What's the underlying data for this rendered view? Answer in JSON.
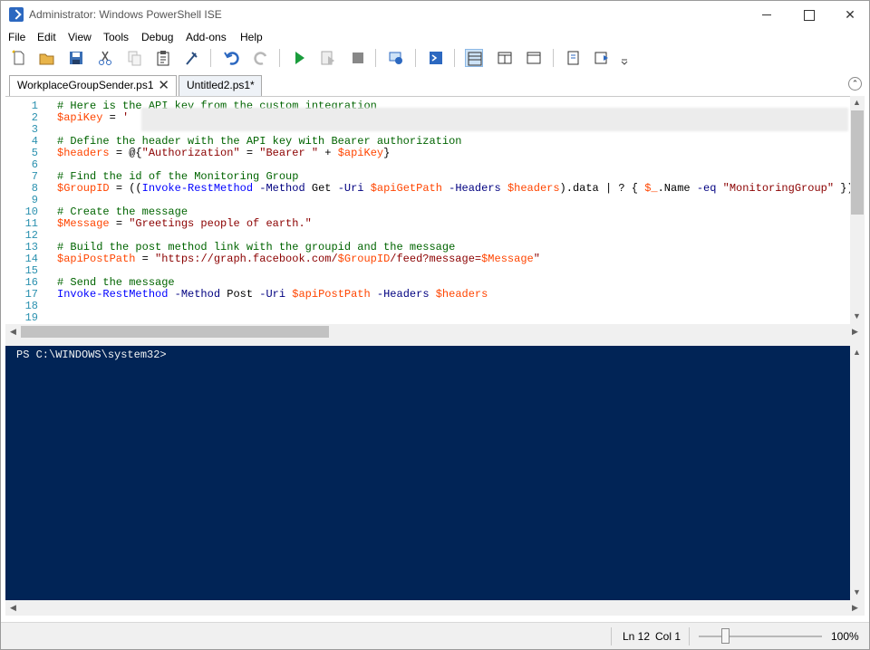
{
  "window": {
    "title": "Administrator: Windows PowerShell ISE"
  },
  "menu": [
    "File",
    "Edit",
    "View",
    "Tools",
    "Debug",
    "Add-ons",
    "Help"
  ],
  "toolbar_icons": [
    "new-script-icon",
    "open-icon",
    "save-icon",
    "cut-icon",
    "copy-icon",
    "paste-icon",
    "clear-console-icon",
    "undo-icon",
    "redo-icon",
    "run-script-icon",
    "run-selection-icon",
    "stop-icon",
    "new-remote-tab-icon",
    "start-powershell-icon",
    "script-pane-top-icon",
    "script-pane-right-icon",
    "script-pane-maximized-icon",
    "show-script-pane-icon",
    "show-command-window-icon",
    "toolbar-overflow-icon"
  ],
  "tabs": [
    {
      "label": "WorkplaceGroupSender.ps1",
      "active": true,
      "close": "✕"
    },
    {
      "label": "Untitled2.ps1*",
      "active": false
    }
  ],
  "script": {
    "lines": [
      {
        "n": "1",
        "text": "# Here is the API key from the custom integration"
      },
      {
        "n": "2",
        "text": "$apiKey = '"
      },
      {
        "n": "3",
        "text": ""
      },
      {
        "n": "4",
        "text": "# Define the header with the API key with Bearer authorization"
      },
      {
        "n": "5",
        "text": "$headers = @{\"Authorization\" = \"Bearer \" + $apiKey}"
      },
      {
        "n": "6",
        "text": ""
      },
      {
        "n": "7",
        "text": "# Find the id of the Monitoring Group"
      },
      {
        "n": "8",
        "text": "$GroupID = ((Invoke-RestMethod -Method Get -Uri $apiGetPath -Headers $headers).data | ? { $_.Name -eq \"MonitoringGroup\" })"
      },
      {
        "n": "9",
        "text": ""
      },
      {
        "n": "10",
        "text": "# Create the message"
      },
      {
        "n": "11",
        "text": "$Message = \"Greetings people of earth.\""
      },
      {
        "n": "12",
        "text": ""
      },
      {
        "n": "13",
        "text": "# Build the post method link with the groupid and the message"
      },
      {
        "n": "14",
        "text": "$apiPostPath = \"https://graph.facebook.com/$GroupID/feed?message=$Message\""
      },
      {
        "n": "15",
        "text": ""
      },
      {
        "n": "16",
        "text": "# Send the message"
      },
      {
        "n": "17",
        "text": "Invoke-RestMethod -Method Post -Uri $apiPostPath -Headers $headers"
      },
      {
        "n": "18",
        "text": ""
      },
      {
        "n": "19",
        "text": ""
      }
    ]
  },
  "console": {
    "prompt": "PS C:\\WINDOWS\\system32>"
  },
  "status": {
    "line": "Ln 12",
    "col": "Col 1",
    "zoom": "100%",
    "zoom_level_percent": 100
  }
}
